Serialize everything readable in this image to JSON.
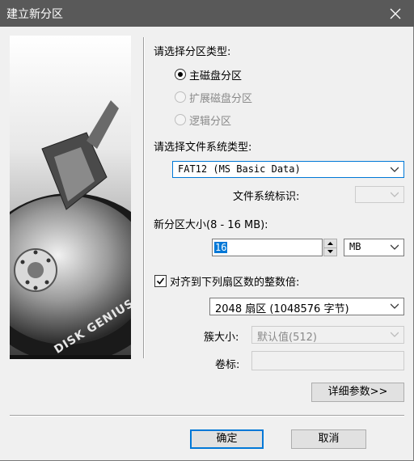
{
  "window": {
    "title": "建立新分区"
  },
  "image": {
    "brand_text": "DISK GENIUS"
  },
  "partition_type": {
    "label": "请选择分区类型:",
    "options": [
      "主磁盘分区",
      "扩展磁盘分区",
      "逻辑分区"
    ],
    "selected": "主磁盘分区"
  },
  "filesystem": {
    "label": "请选择文件系统类型:",
    "selected": "FAT12 (MS Basic Data)",
    "id_label": "文件系统标识:",
    "id_value": ""
  },
  "size": {
    "label": "新分区大小(8 - 16 MB):",
    "value": "16",
    "unit": "MB"
  },
  "align": {
    "checked": true,
    "label": "对齐到下列扇区数的整数倍:",
    "selected": "2048 扇区 (1048576 字节)"
  },
  "cluster": {
    "label": "簇大小:",
    "selected": "默认值(512)"
  },
  "volume": {
    "label": "卷标:",
    "value": ""
  },
  "buttons": {
    "details": "详细参数>>",
    "ok": "确定",
    "cancel": "取消"
  }
}
